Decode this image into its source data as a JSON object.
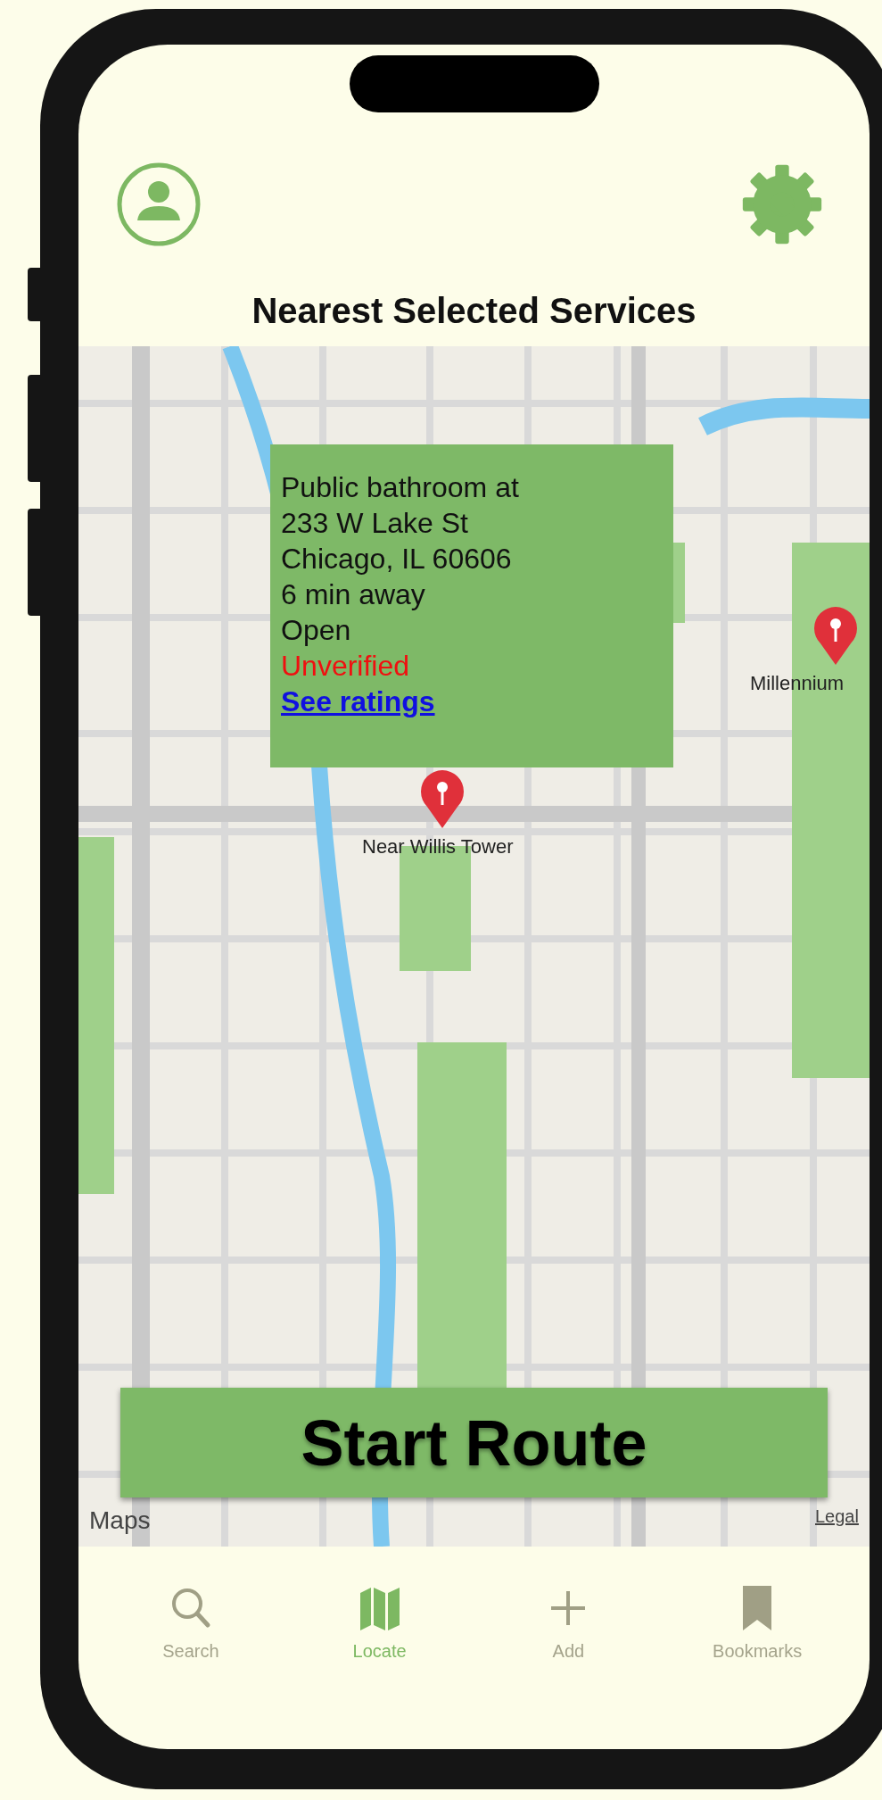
{
  "header": {
    "title": "Nearest Selected Services"
  },
  "map": {
    "info_card": {
      "lines": [
        "Public bathroom at",
        "233 W Lake St",
        "Chicago, IL 60606",
        "6 min away",
        "Open"
      ],
      "status": "Unverified",
      "link": "See ratings"
    },
    "pins": [
      {
        "label": "Near Willis Tower"
      },
      {
        "label": "Millennium"
      }
    ],
    "attribution": "Maps",
    "legal": "Legal"
  },
  "start_button": "Start Route",
  "tabs": [
    {
      "label": "Search",
      "kind": "search",
      "selected": false
    },
    {
      "label": "Locate",
      "kind": "map",
      "selected": true
    },
    {
      "label": "Add",
      "kind": "add",
      "selected": false
    },
    {
      "label": "Bookmarks",
      "kind": "bookmark",
      "selected": false
    }
  ]
}
